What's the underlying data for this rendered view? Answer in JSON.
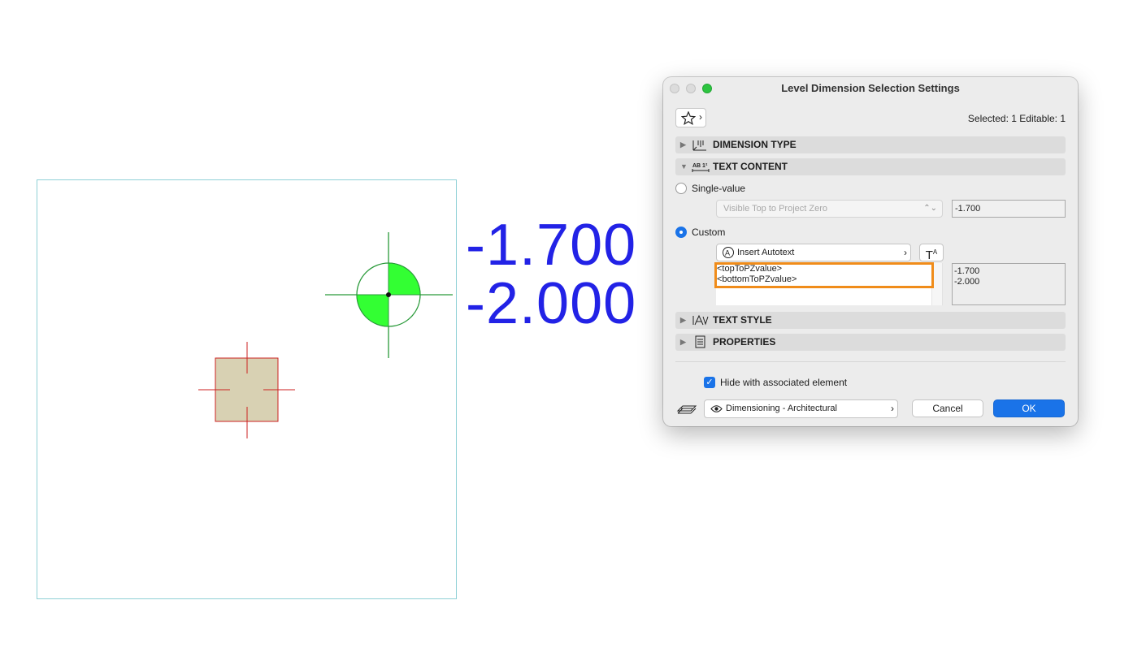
{
  "canvas": {
    "level_values": [
      "-1.700",
      "-2.000"
    ],
    "colors": {
      "frame": "#8fd0d6",
      "level_text": "#2222e6",
      "marker_fill": "#33ff33",
      "marker_stroke": "#2a9a3a",
      "element_fill": "#d8d1b3",
      "element_stroke": "#cc2222"
    }
  },
  "dialog": {
    "title": "Level Dimension Selection Settings",
    "selected_info": "Selected: 1 Editable: 1",
    "sections": {
      "dimension_type": "DIMENSION TYPE",
      "text_content": "TEXT CONTENT",
      "text_style": "TEXT STYLE",
      "properties": "PROPERTIES"
    },
    "single_value": {
      "label": "Single-value",
      "selected": false,
      "popup_value": "Visible Top to Project Zero",
      "value": "-1.700"
    },
    "custom": {
      "label": "Custom",
      "selected": true,
      "insert_autotext_label": "Insert Autotext",
      "text_lines": [
        "<topToPZvalue>",
        "<bottomToPZvalue>"
      ],
      "preview_lines": [
        "-1.700",
        "-2.000"
      ]
    },
    "hide_with_element": {
      "label": "Hide with associated element",
      "checked": true
    },
    "layer": {
      "value": "Dimensioning - Architectural"
    },
    "buttons": {
      "cancel": "Cancel",
      "ok": "OK"
    },
    "colors": {
      "accent": "#1a73e8",
      "highlight": "#f08c1a"
    }
  }
}
